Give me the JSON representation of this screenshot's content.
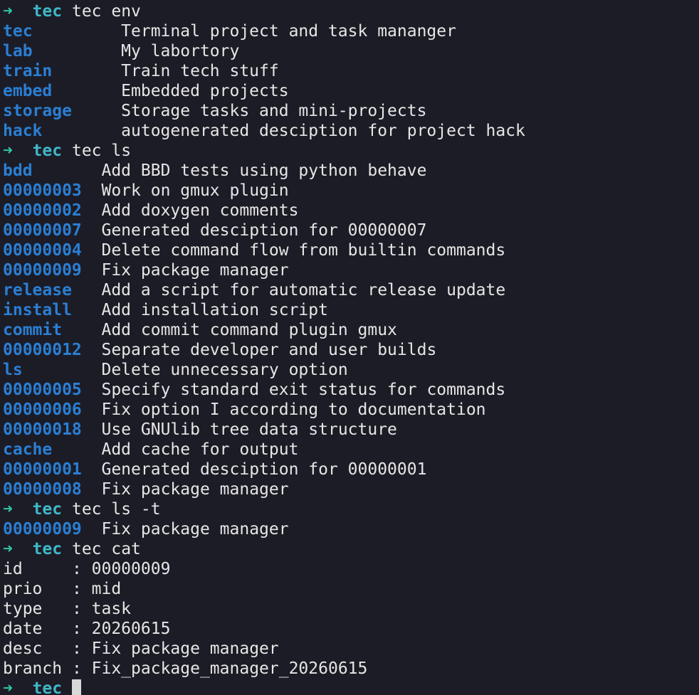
{
  "prompt": {
    "arrow": "➜",
    "dir": "tec"
  },
  "blocks": [
    {
      "type": "command",
      "command": "tec env"
    },
    {
      "type": "table",
      "pad": 12,
      "rows": [
        {
          "key": "tec",
          "value": "Terminal project and task mananger"
        },
        {
          "key": "lab",
          "value": "My labortory"
        },
        {
          "key": "train",
          "value": "Train tech stuff"
        },
        {
          "key": "embed",
          "value": "Embedded projects"
        },
        {
          "key": "storage",
          "value": "Storage tasks and mini-projects"
        },
        {
          "key": "hack",
          "value": "autogenerated desciption for project hack"
        }
      ]
    },
    {
      "type": "command",
      "command": "tec ls"
    },
    {
      "type": "table",
      "pad": 10,
      "rows": [
        {
          "key": "bdd",
          "value": "Add BBD tests using python behave"
        },
        {
          "key": "00000003",
          "value": "Work on gmux plugin"
        },
        {
          "key": "00000002",
          "value": "Add doxygen comments"
        },
        {
          "key": "00000007",
          "value": "Generated desciption for 00000007"
        },
        {
          "key": "00000004",
          "value": "Delete command flow from builtin commands"
        },
        {
          "key": "00000009",
          "value": "Fix package manager"
        },
        {
          "key": "release",
          "value": "Add a script for automatic release update"
        },
        {
          "key": "install",
          "value": "Add installation script"
        },
        {
          "key": "commit",
          "value": "Add commit command plugin gmux"
        },
        {
          "key": "00000012",
          "value": "Separate developer and user builds"
        },
        {
          "key": "ls",
          "value": "Delete unnecessary option"
        },
        {
          "key": "00000005",
          "value": "Specify standard exit status for commands"
        },
        {
          "key": "00000006",
          "value": "Fix option I according to documentation"
        },
        {
          "key": "00000018",
          "value": "Use GNUlib tree data structure"
        },
        {
          "key": "cache",
          "value": "Add cache for output"
        },
        {
          "key": "00000001",
          "value": "Generated desciption for 00000001"
        },
        {
          "key": "00000008",
          "value": "Fix package manager"
        }
      ]
    },
    {
      "type": "command",
      "command": "tec ls -t"
    },
    {
      "type": "table",
      "pad": 10,
      "rows": [
        {
          "key": "00000009",
          "value": "Fix package manager"
        }
      ]
    },
    {
      "type": "command",
      "command": "tec cat"
    },
    {
      "type": "fields",
      "rows": [
        {
          "name": "id     ",
          "value": "00000009"
        },
        {
          "name": "prio   ",
          "value": "mid"
        },
        {
          "name": "type   ",
          "value": "task"
        },
        {
          "name": "date   ",
          "value": "20260615"
        },
        {
          "name": "desc   ",
          "value": "Fix package manager"
        },
        {
          "name": "branch ",
          "value": "Fix_package_manager_20260615"
        }
      ]
    },
    {
      "type": "prompt_active"
    }
  ]
}
